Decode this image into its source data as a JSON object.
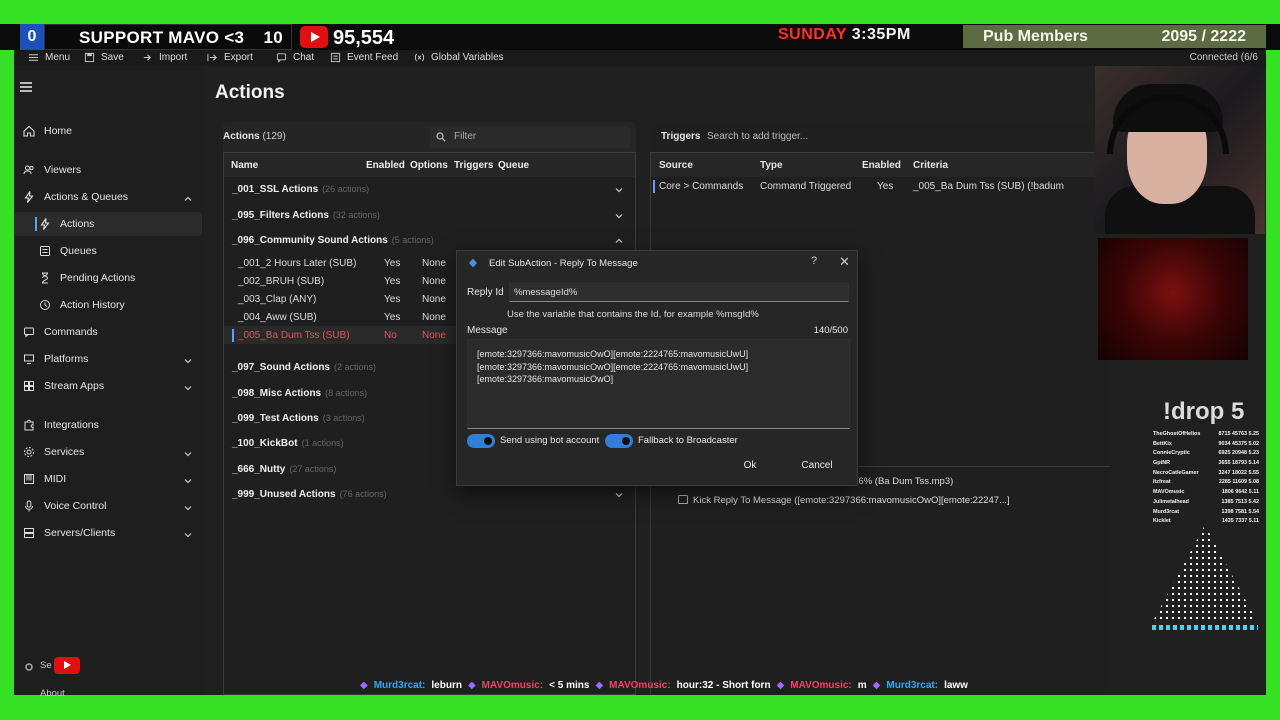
{
  "overlay": {
    "counter": "0",
    "support_text": "SUPPORT MAVO <3",
    "support_count": "10",
    "subscriber_count": "95,554",
    "day": "SUNDAY",
    "time": "3:35PM",
    "pub_label": "Pub Members",
    "pub_value": "2095 / 2222",
    "drop_text": "!drop 5",
    "leaderboard": [
      {
        "name": "TheGhostOfHelios",
        "nums": "8715 45763  5.25"
      },
      {
        "name": "BettKix",
        "nums": "9034 45375  5.02"
      },
      {
        "name": "ConnieCryptic",
        "nums": "6925 20948  5.23"
      },
      {
        "name": "GptNR",
        "nums": "3655 18793  5.14"
      },
      {
        "name": "NecroCatleGamer",
        "nums": "3247 18022  5.55"
      },
      {
        "name": "Itzfreat",
        "nums": "2285 11609  5.08"
      },
      {
        "name": "MAVOmusic",
        "nums": "1806 9642  5.11"
      },
      {
        "name": "Julimetalhead",
        "nums": "1385 7513  5.42"
      },
      {
        "name": "Murd3rcat",
        "nums": "1398 7581  5.54"
      },
      {
        "name": "Kicklet",
        "nums": "1435 7337  5.11"
      }
    ],
    "chat_ticker": [
      {
        "user": "Murd3rcat:",
        "text": "leburn",
        "color": "u1"
      },
      {
        "user": "MAVOmusic:",
        "text": "< 5 mins",
        "color": "u2"
      },
      {
        "user": "MAVOmusic:",
        "text": "hour:32 - Short forn",
        "color": "u2"
      },
      {
        "user": "MAVOmusic:",
        "text": "m",
        "color": "u2"
      },
      {
        "user": "Murd3rcat:",
        "text": "laww",
        "color": "u1"
      }
    ]
  },
  "menubar": {
    "items": [
      "Menu",
      "Save",
      "Import",
      "Export",
      "Chat",
      "Event Feed",
      "Global Variables"
    ],
    "connection": "Connected (6/6"
  },
  "sidebar": {
    "items": [
      {
        "label": "Home",
        "icon": "home-icon"
      },
      {
        "label": "Viewers",
        "icon": "users-icon"
      },
      {
        "label": "Actions & Queues",
        "icon": "lightning-icon",
        "expanded": true
      },
      {
        "label": "Actions",
        "icon": "lightning-icon",
        "sub": true,
        "active": true
      },
      {
        "label": "Queues",
        "icon": "queue-icon",
        "sub": true
      },
      {
        "label": "Pending Actions",
        "icon": "hourglass-icon",
        "sub": true
      },
      {
        "label": "Action History",
        "icon": "history-icon",
        "sub": true
      },
      {
        "label": "Commands",
        "icon": "command-icon"
      },
      {
        "label": "Platforms",
        "icon": "platforms-icon",
        "collapsed": true
      },
      {
        "label": "Stream Apps",
        "icon": "apps-icon",
        "collapsed": true
      },
      {
        "label": "Integrations",
        "icon": "puzzle-icon"
      },
      {
        "label": "Services",
        "icon": "gear-icon",
        "collapsed": true
      },
      {
        "label": "MIDI",
        "icon": "midi-icon",
        "collapsed": true
      },
      {
        "label": "Voice Control",
        "icon": "microphone-icon",
        "collapsed": true
      },
      {
        "label": "Servers/Clients",
        "icon": "server-icon",
        "collapsed": true
      }
    ],
    "settings_label": "Se",
    "about_label": "About"
  },
  "main": {
    "title": "Actions",
    "actions": {
      "label": "Actions",
      "count": "(129)",
      "filter_placeholder": "Filter",
      "columns": [
        "Name",
        "Enabled",
        "Options",
        "Triggers",
        "Queue"
      ],
      "groups": [
        {
          "name": "_001_SSL Actions",
          "count": "(26 actions)"
        },
        {
          "name": "_095_Filters Actions",
          "count": "(32 actions)"
        },
        {
          "name": "_096_Community Sound Actions",
          "count": "(5 actions)",
          "expanded": true
        },
        {
          "name": "_097_Sound Actions",
          "count": "(2 actions)"
        },
        {
          "name": "_098_Misc Actions",
          "count": "(8 actions)"
        },
        {
          "name": "_099_Test Actions",
          "count": "(3 actions)"
        },
        {
          "name": "_100_KickBot",
          "count": "(1 actions)"
        },
        {
          "name": "_666_Nutty",
          "count": "(27 actions)"
        },
        {
          "name": "_999_Unused Actions",
          "count": "(76 actions)"
        }
      ],
      "rows": [
        {
          "name": "_001_2 Hours Later (SUB)",
          "enabled": "Yes",
          "queue": "None"
        },
        {
          "name": "_002_BRUH (SUB)",
          "enabled": "Yes",
          "queue": "None"
        },
        {
          "name": "_003_Clap (ANY)",
          "enabled": "Yes",
          "queue": "None"
        },
        {
          "name": "_004_Aww (SUB)",
          "enabled": "Yes",
          "queue": "None"
        },
        {
          "name": "_005_Ba Dum Tss (SUB)",
          "enabled": "No",
          "queue": "None",
          "selected": true
        }
      ]
    },
    "triggers": {
      "label": "Triggers",
      "search_placeholder": "Search to add trigger...",
      "columns": [
        "Source",
        "Type",
        "Enabled",
        "Criteria"
      ],
      "rows": [
        {
          "source": "Core > Commands",
          "type": "Command Triggered",
          "enabled": "Yes",
          "criteria": "_005_Ba Dum Tss (SUB) (!badum"
        }
      ]
    },
    "subactions": {
      "rows": [
        {
          "text": "at 116% (Ba Dum Tss.mp3)"
        },
        {
          "text": "Kick Reply To Message ([emote:3297366:mavomusicOwO][emote:22247...]"
        }
      ]
    }
  },
  "dialog": {
    "title": "Edit SubAction - Reply To Message",
    "help": "?",
    "close": "✕",
    "reply_id_label": "Reply Id",
    "reply_id_value": "%messageId%",
    "hint": "Use the variable that contains the Id, for example %msgId%",
    "message_label": "Message",
    "message_count": "140/500",
    "message_value": "[emote:3297366:mavomusicOwO][emote:2224765:mavomusicUwU]\n[emote:3297366:mavomusicOwO][emote:2224765:mavomusicUwU]\n[emote:3297366:mavomusicOwO]",
    "toggle_bot_label": "Send using bot account",
    "toggle_fallback_label": "Fallback to Broadcaster",
    "ok_label": "Ok",
    "cancel_label": "Cancel"
  }
}
